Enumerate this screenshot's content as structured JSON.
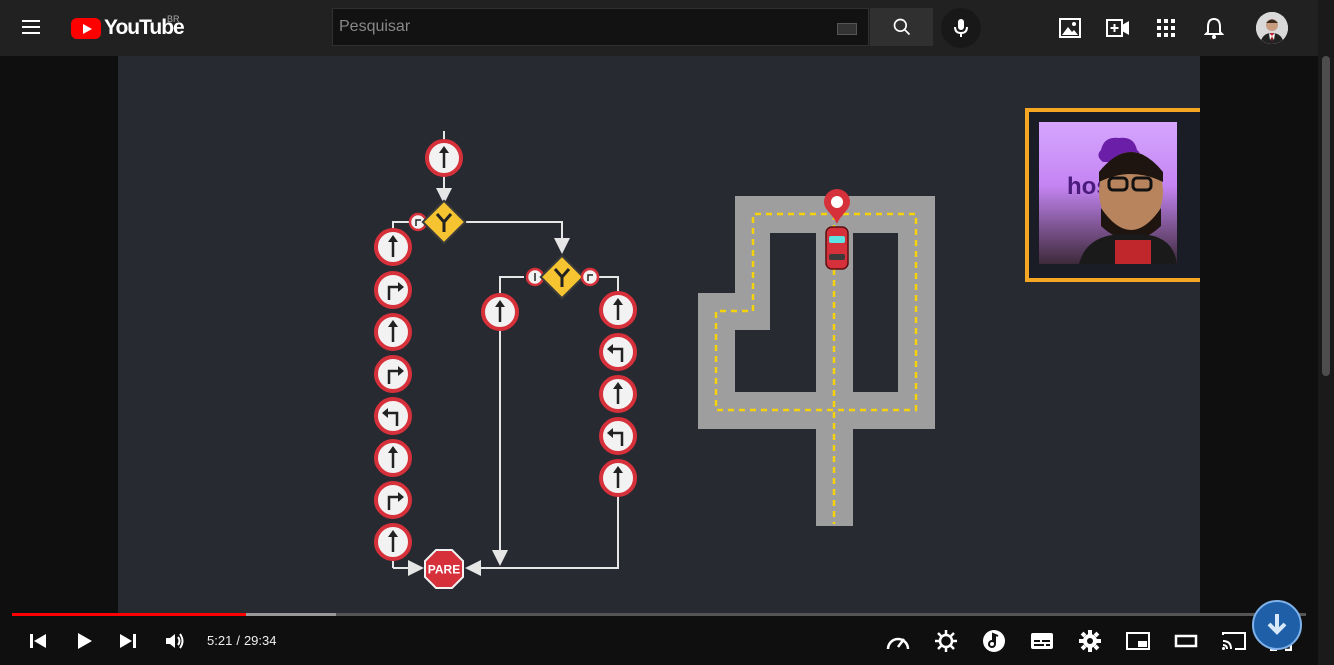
{
  "header": {
    "logo_text": "YouTube",
    "region": "BR",
    "search_placeholder": "Pesquisar"
  },
  "icons": {
    "menu": "hamburger-icon",
    "search": "search-icon",
    "mic": "microphone-icon",
    "create_post": "image-icon",
    "create_video": "video-add-icon",
    "apps": "apps-grid-icon",
    "notifications": "bell-icon"
  },
  "video": {
    "stop_sign_text": "PARE",
    "facecam_text": "hos"
  },
  "player": {
    "current_time": "5:21",
    "separator": "/",
    "duration": "29:34",
    "played_fraction": 0.181,
    "buffered_fraction": 0.25
  },
  "colors": {
    "accent": "#ff0000",
    "video_bg": "#272a31",
    "sign_red": "#d6303a",
    "sign_yellow": "#f5c430",
    "road": "#9e9e9e",
    "road_line": "#f5d20a",
    "facecam_border": "#f5a623"
  }
}
